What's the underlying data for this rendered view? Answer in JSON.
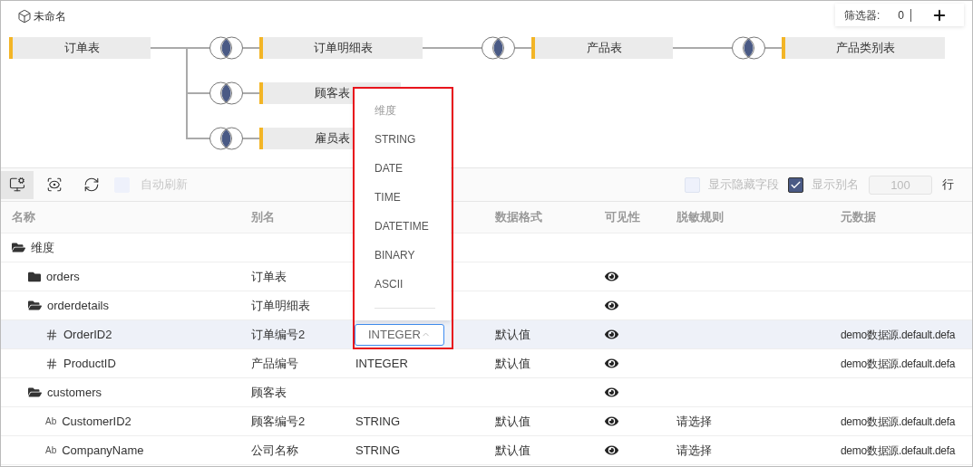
{
  "title": "未命名",
  "filter": {
    "label": "筛选器:",
    "count": "0"
  },
  "diagram": {
    "name": "订单表",
    "children": [
      {
        "name": "订单明细表",
        "children": [
          {
            "name": "产品表",
            "children": [
              {
                "name": "产品类别表"
              }
            ]
          }
        ]
      },
      {
        "name": "顾客表"
      },
      {
        "name": "雇员表"
      }
    ]
  },
  "toolbar": {
    "tools": [
      {
        "kind": "settings",
        "selected": true
      },
      {
        "kind": "preview",
        "selected": false
      },
      {
        "kind": "refresh",
        "selected": false
      }
    ],
    "auto_refresh": {
      "label": "自动刷新",
      "checked": false,
      "disabled": true
    },
    "show_hidden": {
      "label": "显示隐藏字段",
      "checked": false
    },
    "show_alias": {
      "label": "显示别名",
      "checked": true
    },
    "row_limit": {
      "value": "100",
      "disabled": true
    },
    "row_unit": "行"
  },
  "table": {
    "columns": [
      "名称",
      "别名",
      null,
      "数据格式",
      "可见性",
      "脱敏规则",
      "元数据"
    ],
    "rows": [
      {
        "kind": "folder",
        "name": "维度",
        "expanded": true,
        "selected": false,
        "children": [
          {
            "kind": "folder",
            "name": "orders",
            "alias": "订单表",
            "expanded": false,
            "visible": true,
            "selected": false
          },
          {
            "kind": "folder",
            "name": "orderdetails",
            "alias": "订单明细表",
            "expanded": true,
            "visible": true,
            "selected": false,
            "children": [
              {
                "kind": "number",
                "name": "OrderID2",
                "alias": "订单编号2",
                "type": "INTEGER",
                "type_open": true,
                "format": "默认值",
                "visible": true,
                "metadata": "demo数据源.default.defa",
                "selected": true
              },
              {
                "kind": "number",
                "name": "ProductID",
                "alias": "产品编号",
                "type": "INTEGER",
                "type_open": false,
                "format": "默认值",
                "visible": true,
                "metadata": "demo数据源.default.defa",
                "selected": false
              }
            ]
          },
          {
            "kind": "folder",
            "name": "customers",
            "alias": "顾客表",
            "expanded": true,
            "visible": true,
            "selected": false,
            "children": [
              {
                "kind": "string",
                "icon_text": "Ab",
                "name": "CustomerID2",
                "alias": "顾客编号2",
                "type": "STRING",
                "type_open": false,
                "format": "默认值",
                "visible": true,
                "mask": "请选择",
                "metadata": "demo数据源.default.defa",
                "selected": false
              },
              {
                "kind": "string",
                "icon_text": "Ab",
                "name": "CompanyName",
                "alias": "公司名称",
                "type": "STRING",
                "type_open": false,
                "format": "默认值",
                "visible": true,
                "mask": "请选择",
                "metadata": "demo数据源.default.defa",
                "selected": false
              }
            ]
          }
        ]
      }
    ]
  },
  "type_menu": {
    "options": [
      {
        "label": "维度",
        "disabled": true
      },
      {
        "label": "STRING",
        "disabled": false
      },
      {
        "label": "DATE",
        "disabled": false
      },
      {
        "label": "TIME",
        "disabled": false
      },
      {
        "label": "DATETIME",
        "disabled": false
      },
      {
        "label": "BINARY",
        "disabled": false
      },
      {
        "label": "ASCII",
        "disabled": false
      }
    ]
  }
}
